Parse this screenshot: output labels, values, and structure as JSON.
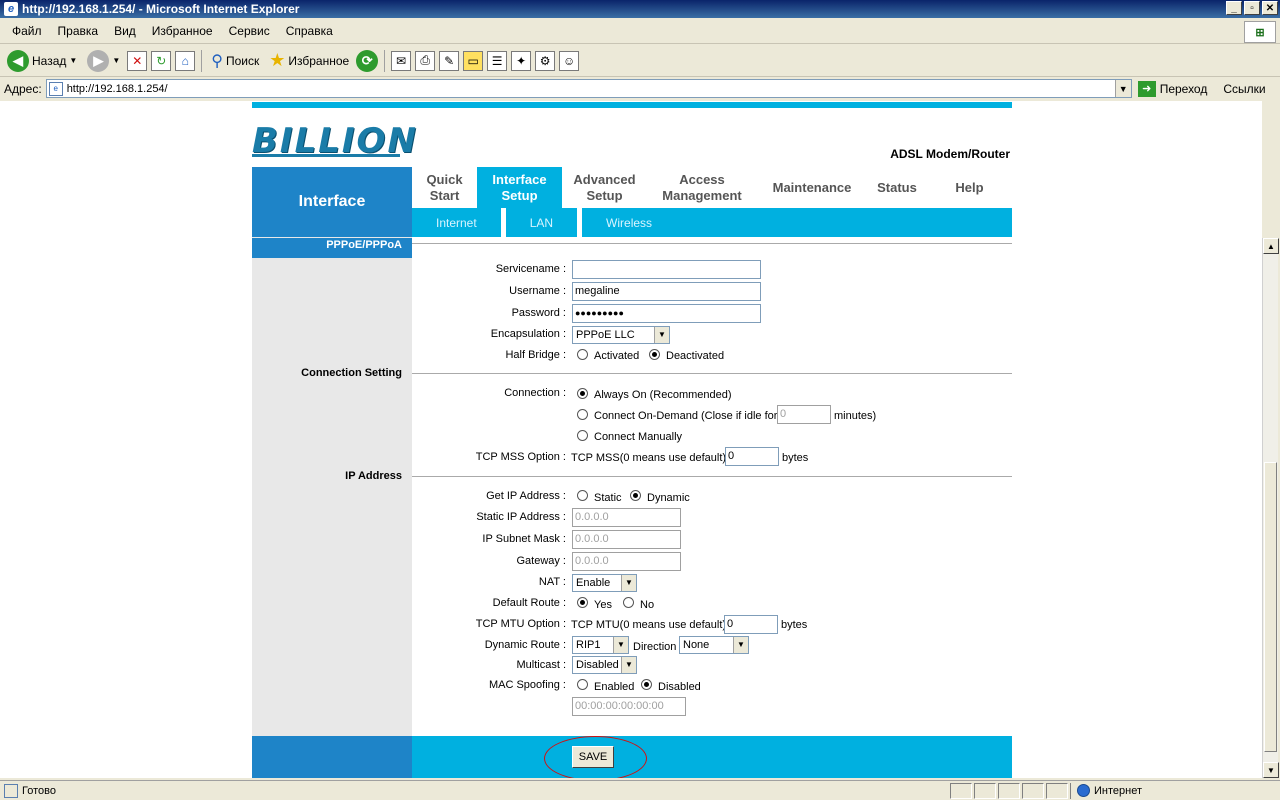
{
  "window": {
    "title": "http://192.168.1.254/ - Microsoft Internet Explorer"
  },
  "menu": [
    "Файл",
    "Правка",
    "Вид",
    "Избранное",
    "Сервис",
    "Справка"
  ],
  "toolbar": {
    "back": "Назад",
    "search": "Поиск",
    "favorites": "Избранное"
  },
  "address": {
    "label": "Адрес:",
    "url": "http://192.168.1.254/",
    "go": "Переход",
    "links": "Ссылки"
  },
  "page": {
    "brand": "BILLION",
    "product": "ADSL Modem/Router",
    "side_title": "Interface",
    "tabs": [
      "Quick Start",
      "Interface Setup",
      "Advanced Setup",
      "Access Management",
      "Maintenance",
      "Status",
      "Help"
    ],
    "active_tab": "Interface Setup",
    "subtabs": [
      "Internet",
      "LAN",
      "Wireless"
    ],
    "section_pppoe": "PPPoE/PPPoA",
    "section_connection": "Connection Setting",
    "section_ip": "IP Address"
  },
  "form": {
    "servicename": {
      "label": "Servicename :",
      "value": ""
    },
    "username": {
      "label": "Username :",
      "value": "megaline"
    },
    "password": {
      "label": "Password :",
      "value": "●●●●●●●●●"
    },
    "encapsulation": {
      "label": "Encapsulation :",
      "value": "PPPoE LLC"
    },
    "half_bridge": {
      "label": "Half Bridge :",
      "opt1": "Activated",
      "opt2": "Deactivated",
      "selected": "Deactivated"
    },
    "connection": {
      "label": "Connection :",
      "opt1": "Always On (Recommended)",
      "opt2": "Connect On-Demand (Close if idle for",
      "opt2_value": "0",
      "opt2_unit": "minutes)",
      "opt3": "Connect Manually",
      "selected": "Always On (Recommended)"
    },
    "tcp_mss": {
      "label": "TCP MSS Option :",
      "text": "TCP MSS(0 means use default)",
      "value": "0",
      "unit": "bytes"
    },
    "get_ip": {
      "label": "Get IP Address :",
      "opt1": "Static",
      "opt2": "Dynamic",
      "selected": "Dynamic"
    },
    "static_ip": {
      "label": "Static IP Address :",
      "value": "0.0.0.0"
    },
    "subnet": {
      "label": "IP Subnet Mask :",
      "value": "0.0.0.0"
    },
    "gateway": {
      "label": "Gateway :",
      "value": "0.0.0.0"
    },
    "nat": {
      "label": "NAT :",
      "value": "Enable"
    },
    "default_route": {
      "label": "Default Route :",
      "opt1": "Yes",
      "opt2": "No",
      "selected": "Yes"
    },
    "tcp_mtu": {
      "label": "TCP MTU Option :",
      "text": "TCP MTU(0 means use default)",
      "value": "0",
      "unit": "bytes"
    },
    "dynamic_route": {
      "label": "Dynamic Route :",
      "value": "RIP1",
      "direction_label": "Direction",
      "direction": "None"
    },
    "multicast": {
      "label": "Multicast :",
      "value": "Disabled"
    },
    "mac_spoofing": {
      "label": "MAC Spoofing :",
      "opt1": "Enabled",
      "opt2": "Disabled",
      "selected": "Disabled",
      "mac": "00:00:00:00:00:00"
    },
    "save": "SAVE"
  },
  "status": {
    "text": "Готово",
    "zone": "Интернет"
  }
}
